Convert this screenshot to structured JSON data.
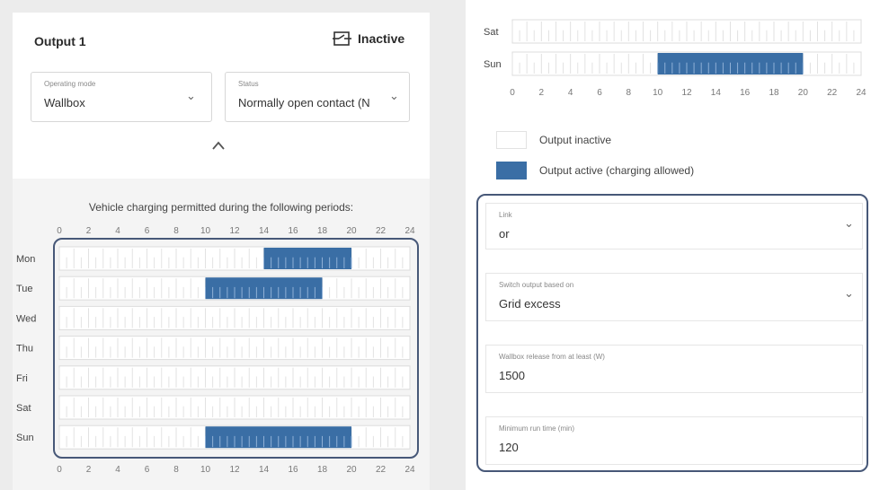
{
  "left_panel": {
    "title": "Output 1",
    "status_label": "Inactive",
    "operating_mode": {
      "label": "Operating mode",
      "value": "Wallbox"
    },
    "status_field": {
      "label": "Status",
      "value": "Normally open contact (N"
    },
    "caption": "Vehicle charging permitted during the following periods:",
    "hour_ticks": [
      "0",
      "2",
      "4",
      "6",
      "8",
      "10",
      "12",
      "14",
      "16",
      "18",
      "20",
      "22",
      "24"
    ],
    "days": [
      {
        "label": "Mon",
        "active_start": 14,
        "active_end": 20
      },
      {
        "label": "Tue",
        "active_start": 10,
        "active_end": 18
      },
      {
        "label": "Wed",
        "active_start": null,
        "active_end": null
      },
      {
        "label": "Thu",
        "active_start": null,
        "active_end": null
      },
      {
        "label": "Fri",
        "active_start": null,
        "active_end": null
      },
      {
        "label": "Sat",
        "active_start": null,
        "active_end": null
      },
      {
        "label": "Sun",
        "active_start": 10,
        "active_end": 20
      }
    ]
  },
  "right_panel": {
    "days": [
      {
        "label": "Sat",
        "active_start": null,
        "active_end": null
      },
      {
        "label": "Sun",
        "active_start": 10,
        "active_end": 20
      }
    ],
    "hour_ticks": [
      "0",
      "2",
      "4",
      "6",
      "8",
      "10",
      "12",
      "14",
      "16",
      "18",
      "20",
      "22",
      "24"
    ],
    "legend": {
      "inactive": "Output inactive",
      "active": "Output active (charging allowed)"
    },
    "fields": [
      {
        "label": "Link",
        "value": "or",
        "dropdown": true
      },
      {
        "label": "Switch output based on",
        "value": "Grid excess",
        "dropdown": true
      },
      {
        "label": "Wallbox release from at least (W)",
        "value": "1500",
        "dropdown": false
      },
      {
        "label": "Minimum run time (min)",
        "value": "120",
        "dropdown": false
      }
    ]
  },
  "colors": {
    "active": "#3a6ea5",
    "highlight_border": "#475878",
    "grid": "#dcdcdc"
  }
}
